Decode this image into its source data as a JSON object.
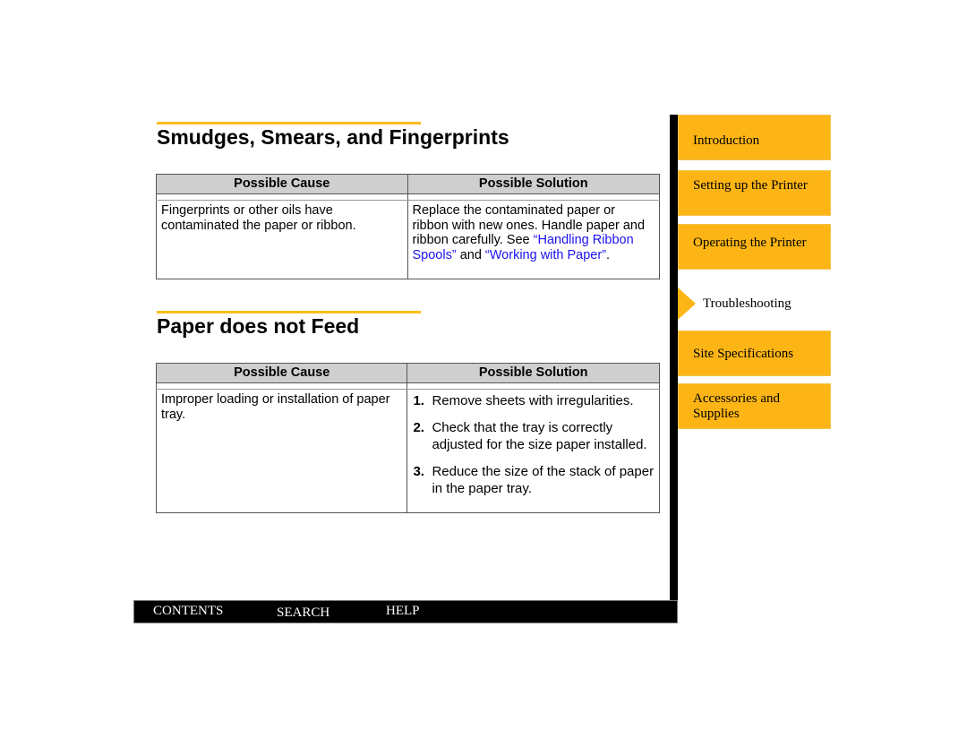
{
  "sections": [
    {
      "title": "Smudges, Smears, and Fingerprints",
      "table": {
        "headers": [
          "Possible Cause",
          "Possible Solution"
        ],
        "cause": "Fingerprints or other oils have contaminated the paper or ribbon.",
        "solution": {
          "text_before": "Replace the contaminated paper or ribbon with new ones. Handle paper and ribbon carefully. See ",
          "link1": "“Handling Ribbon Spools”",
          "text_middle": " and ",
          "link2": "“Working with Paper”",
          "text_after": "."
        }
      }
    },
    {
      "title": "Paper does not Feed",
      "table": {
        "headers": [
          "Possible Cause",
          "Possible Solution"
        ],
        "cause": "Improper loading or installation of paper tray.",
        "steps": [
          {
            "num": "1.",
            "text": "Remove sheets with irregularities."
          },
          {
            "num": "2.",
            "text": "Check that the tray is correctly adjusted for the size paper installed."
          },
          {
            "num": "3.",
            "text": "Reduce the size of the stack of paper in the paper tray."
          }
        ]
      }
    }
  ],
  "nav": {
    "items": [
      {
        "label": "Introduction"
      },
      {
        "label": "Setting up the Printer"
      },
      {
        "label": "Operating the Printer"
      },
      {
        "label": "Troubleshooting",
        "active": true
      },
      {
        "label": "Site Specifications"
      },
      {
        "label": "Accessories and Supplies"
      }
    ]
  },
  "footer": {
    "contents": "CONTENTS",
    "search": "SEARCH",
    "help": "HELP"
  },
  "colors": {
    "accent": "#fdb515",
    "rule": "#fcbc1c",
    "link": "#1b12ee",
    "table_header": "#cfcfcf"
  }
}
